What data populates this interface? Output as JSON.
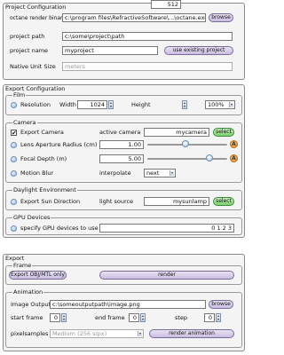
{
  "project_config": {
    "title": "Project Configuration",
    "binary_label": "octane render binary",
    "binary_value": "c:\\program files\\RefractiveSoftware\\...\\octane.exe",
    "browse_label": "browse",
    "path_label": "project path",
    "path_value": "c:\\some\\project\\path",
    "name_label": "project name",
    "name_value": "myproject",
    "use_existing_label": "use existing project",
    "unit_label": "Native Unit Size",
    "unit_value": "meters"
  },
  "export_config": {
    "title": "Export Configuration",
    "film": {
      "title": "Film",
      "resolution_label": "Resolution",
      "width_label": "Width",
      "width_value": "1024",
      "height_label": "Height",
      "height_value": "512",
      "percent_value": "100%"
    },
    "camera": {
      "title": "Camera",
      "export_camera_label": "Export Camera",
      "export_camera_checked": true,
      "active_camera_label": "active camera",
      "active_camera_value": "mycamera",
      "select_label": "select",
      "lens_label": "Lens Aperture Radius (cm)",
      "lens_value": "1.00",
      "lens_level": 0.48,
      "focal_label": "Focal Depth (m)",
      "focal_value": "5.00",
      "focal_level": 0.78,
      "a_label": "A",
      "motion_label": "Motion Blur",
      "interpolate_label": "interpolate",
      "interpolate_value": "next"
    },
    "daylight": {
      "title": "Daylight Environment",
      "export_sun_label": "Export Sun Direction",
      "light_source_label": "light source",
      "light_source_value": "mysunlamp",
      "select_label": "select"
    },
    "gpu": {
      "title": "GPU Devices",
      "specify_label": "specify GPU devices to use",
      "devices_value": "0 1 2 3"
    }
  },
  "export": {
    "title": "Export",
    "frame": {
      "title": "Frame",
      "export_obj_label": "Export OBJ/MTL only",
      "render_label": "render"
    },
    "animation": {
      "title": "Animation",
      "image_output_label": "Image Output",
      "image_output_value": "c:\\someoutputpath\\image.png",
      "browse_label": "browse",
      "start_label": "start frame",
      "start_value": "0",
      "end_label": "end frame",
      "end_value": "0",
      "step_label": "step",
      "step_value": "0",
      "pixelsamples_label": "pixelsamples",
      "pixelsamples_value": "Medium (256 s/px)",
      "render_animation_label": "render animation"
    }
  }
}
